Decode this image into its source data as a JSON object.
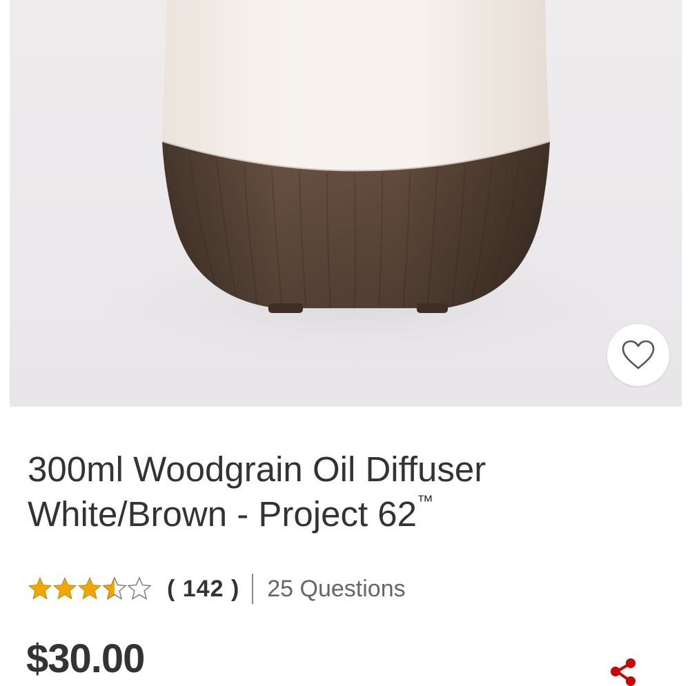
{
  "product": {
    "title_line1": "300ml Woodgrain Oil Diffuser",
    "title_line2": "White/Brown - Project 62",
    "trademark": "™",
    "price": "$30.00",
    "image_alt": "300ml Woodgrain Oil Diffuser White/Brown"
  },
  "rating": {
    "value": 3.5,
    "max": 5,
    "review_count": "( 142 )",
    "questions": "25 Questions",
    "star_color": "#f0a800"
  },
  "icons": {
    "favorite": "heart-outline-icon",
    "share": "share-icon"
  },
  "colors": {
    "share_accent": "#cc0000",
    "text": "#333333"
  }
}
